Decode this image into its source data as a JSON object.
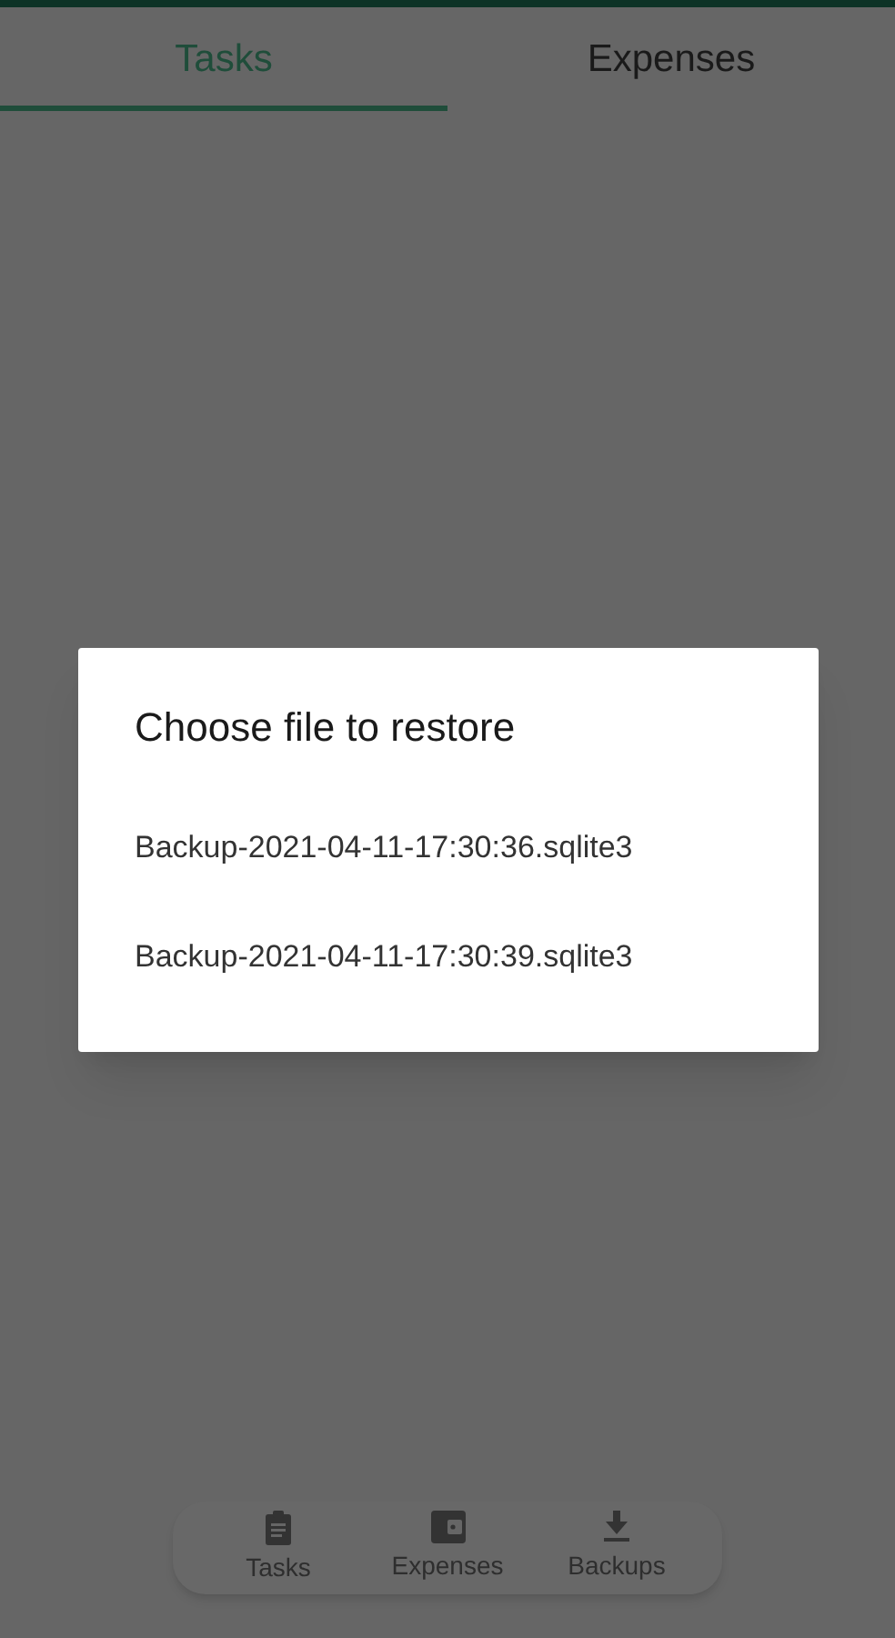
{
  "tabs": [
    {
      "label": "Tasks",
      "selected": true
    },
    {
      "label": "Expenses",
      "selected": false
    }
  ],
  "dialog": {
    "title": "Choose file to restore",
    "items": [
      "Backup-2021-04-11-17:30:36.sqlite3",
      "Backup-2021-04-11-17:30:39.sqlite3"
    ]
  },
  "bottom_nav": [
    {
      "kind": "tasks",
      "label": "Tasks"
    },
    {
      "kind": "expenses",
      "label": "Expenses"
    },
    {
      "kind": "backups",
      "label": "Backups"
    }
  ]
}
